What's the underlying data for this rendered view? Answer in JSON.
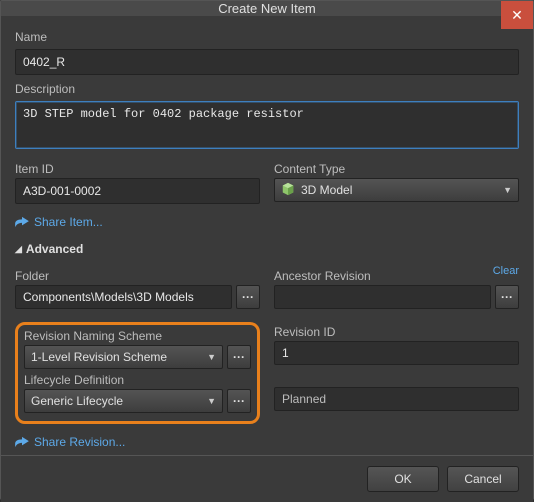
{
  "title": "Create New Item",
  "labels": {
    "name": "Name",
    "description": "Description",
    "itemId": "Item ID",
    "contentType": "Content Type",
    "folder": "Folder",
    "ancestor": "Ancestor Revision",
    "revScheme": "Revision Naming Scheme",
    "lifecycle": "Lifecycle Definition",
    "revisionId": "Revision ID",
    "advanced": "Advanced",
    "clear": "Clear"
  },
  "values": {
    "name": "0402_R",
    "description": "3D STEP model for 0402 package resistor",
    "itemId": "A3D-001-0002",
    "contentType": "3D Model",
    "folder": "Components\\Models\\3D Models",
    "ancestor": "",
    "revScheme": "1-Level Revision Scheme",
    "lifecycle": "Generic Lifecycle",
    "revisionId": "1",
    "lifecycleState": "Planned"
  },
  "links": {
    "shareItem": "Share Item...",
    "shareRevision": "Share Revision..."
  },
  "buttons": {
    "ok": "OK",
    "cancel": "Cancel"
  }
}
